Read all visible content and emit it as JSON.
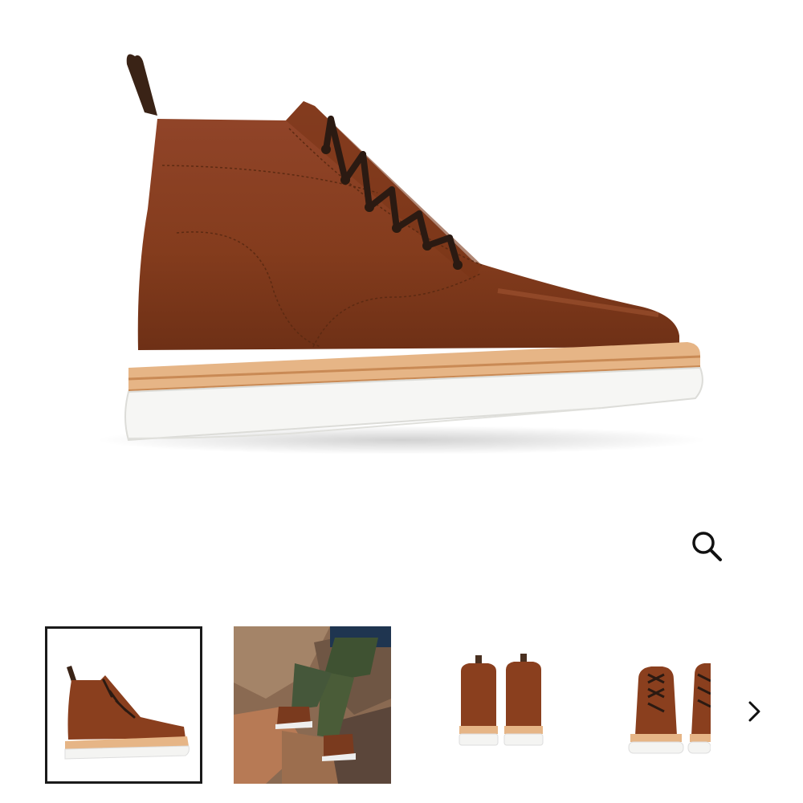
{
  "product": {
    "main_image_icon": "boot-side-view-image",
    "leather_color": "#8a3f1e",
    "sole_color": "#f4f4f2",
    "welt_color": "#e2b07e"
  },
  "gallery": {
    "zoom_icon": "magnifier-icon",
    "next_icon": "chevron-right-icon",
    "selected_index": 0,
    "thumbnails": [
      {
        "icon": "boot-side-thumbnail",
        "selected": true
      },
      {
        "icon": "lifestyle-rocks-thumbnail",
        "selected": false
      },
      {
        "icon": "boots-back-view-thumbnail",
        "selected": false
      },
      {
        "icon": "boots-front-view-thumbnail",
        "selected": false
      }
    ]
  }
}
